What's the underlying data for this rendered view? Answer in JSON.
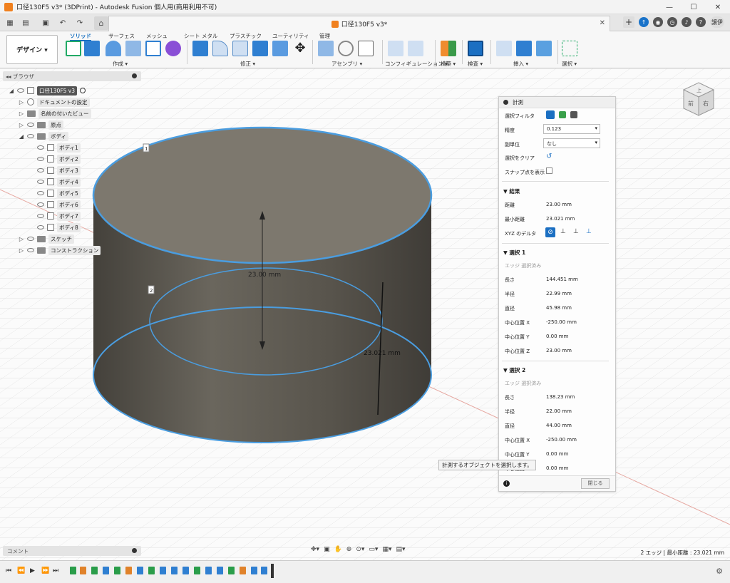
{
  "window": {
    "title": "口径130F5 v3* (3DPrint) - Autodesk Fusion 個人用(商用利用不可)"
  },
  "tab": {
    "doc_title": "口径130F5 v3*",
    "user_label": "譲伊"
  },
  "ribbon": {
    "design_label": "デザイン ▾",
    "tabs": [
      "ソリッド",
      "サーフェス",
      "メッシュ",
      "シート メタル",
      "プラスチック",
      "ユーティリティ",
      "管理"
    ],
    "groups": [
      "作成 ▾",
      "修正 ▾",
      "アセンブリ ▾",
      "コンフィギュレーション ▾",
      "構築 ▾",
      "検査 ▾",
      "挿入 ▾",
      "選択 ▾"
    ]
  },
  "browser": {
    "header": "ブラウザ",
    "root": "口径130F5 v3",
    "nodes": [
      "ドキュメントの設定",
      "名前の付いたビュー",
      "原点",
      "ボディ",
      "スケッチ",
      "コンストラクション"
    ],
    "bodies": [
      "ボディ1",
      "ボディ2",
      "ボディ3",
      "ボディ4",
      "ボディ5",
      "ボディ6",
      "ボディ7",
      "ボディ8"
    ]
  },
  "viewport": {
    "dim_label": "23.00 mm",
    "dim_label2": "23.021 mm",
    "marker1": "1",
    "marker2": "2",
    "tooltip": "計測するオブジェクトを選択します。",
    "status": "2 エッジ | 最小距離 : 23.021 mm"
  },
  "measure": {
    "title": "計測",
    "filter_label": "選択フィルタ",
    "precision_label": "精度",
    "precision_value": "0.123",
    "subunit_label": "副単位",
    "subunit_value": "なし",
    "clear_label": "選択をクリア",
    "snap_label": "スナップ点を表示",
    "results_label": "結果",
    "distance_label": "距離",
    "distance_value": "23.00 mm",
    "min_distance_label": "最小距離",
    "min_distance_value": "23.021 mm",
    "xyz_label": "XYZ のデルタ",
    "sel1": {
      "header": "選択 1",
      "type": "エッジ 選択済み",
      "rows": [
        {
          "label": "長さ",
          "value": "144.451 mm"
        },
        {
          "label": "半径",
          "value": "22.99 mm"
        },
        {
          "label": "直径",
          "value": "45.98 mm"
        },
        {
          "label": "中心位置 X",
          "value": "-250.00 mm"
        },
        {
          "label": "中心位置 Y",
          "value": "0.00 mm"
        },
        {
          "label": "中心位置 Z",
          "value": "23.00 mm"
        }
      ]
    },
    "sel2": {
      "header": "選択 2",
      "type": "エッジ 選択済み",
      "rows": [
        {
          "label": "長さ",
          "value": "138.23 mm"
        },
        {
          "label": "半径",
          "value": "22.00 mm"
        },
        {
          "label": "直径",
          "value": "44.00 mm"
        },
        {
          "label": "中心位置 X",
          "value": "-250.00 mm"
        },
        {
          "label": "中心位置 Y",
          "value": "0.00 mm"
        },
        {
          "label": "中心位置 Z",
          "value": "0.00 mm"
        }
      ]
    },
    "close_label": "閉じる"
  },
  "comment": {
    "label": "コメント"
  },
  "colors": {
    "accent": "#0f6bbf",
    "selection": "#4a9de0",
    "body": "#5b5750"
  }
}
